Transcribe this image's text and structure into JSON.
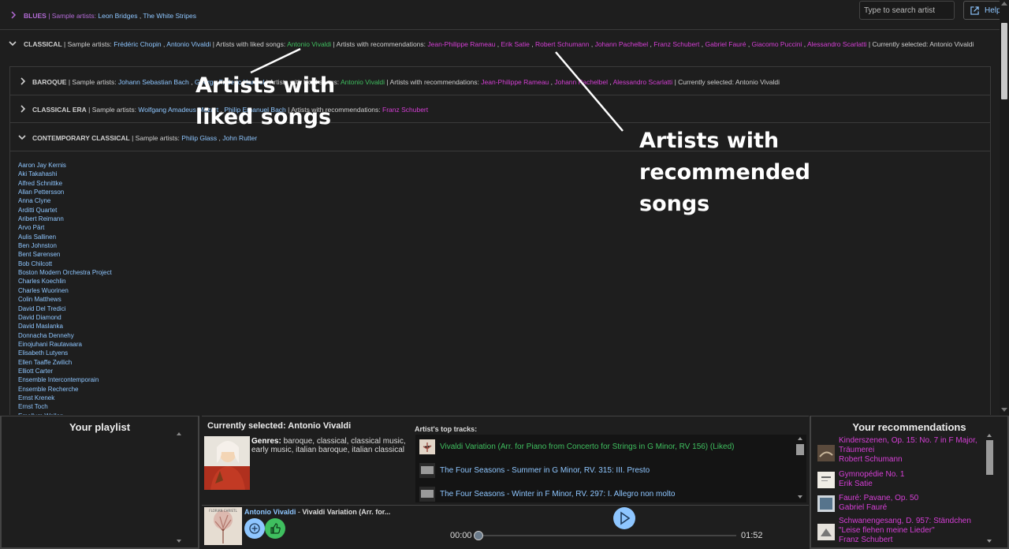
{
  "search": {
    "placeholder": "Type to search artist"
  },
  "help_label": "Help",
  "genres": {
    "blues": {
      "name": "BLUES",
      "sample_label": "| Sample artists:",
      "sample_artists": [
        "Leon Bridges",
        "The White Stripes"
      ]
    },
    "classical": {
      "name": "CLASSICAL",
      "sample_label": "| Sample artists:",
      "sample_artists": [
        "Frédéric Chopin",
        "Antonio Vivaldi"
      ],
      "liked_label": "| Artists with liked songs:",
      "liked_artists": [
        "Antonio Vivaldi"
      ],
      "rec_label": "| Artists with recommendations:",
      "rec_artists": [
        "Jean-Philippe Rameau",
        "Erik Satie",
        "Robert Schumann",
        "Johann Pachelbel",
        "Franz Schubert",
        "Gabriel Fauré",
        "Giacomo Puccini",
        "Alessandro Scarlatti"
      ],
      "selected_text": "| Currently selected: Antonio Vivaldi"
    },
    "baroque": {
      "name": "BAROQUE",
      "sample_label": "| Sample artists:",
      "sample_artists": [
        "Johann Sebastian Bach",
        "George Frideric Handel"
      ],
      "liked_label": "| Artists with liked songs:",
      "liked_artists": [
        "Antonio Vivaldi"
      ],
      "rec_label": "| Artists with recommendations:",
      "rec_artists": [
        "Jean-Philippe Rameau",
        "Johann Pachelbel",
        "Alessandro Scarlatti"
      ],
      "selected_text": "| Currently selected: Antonio Vivaldi"
    },
    "classical_era": {
      "name": "CLASSICAL ERA",
      "sample_label": "| Sample artists:",
      "sample_artists": [
        "Wolfgang Amadeus Mozart",
        "Philip Emanuel Bach"
      ],
      "rec_label": "| Artists with recommendations:",
      "rec_artists": [
        "Franz Schubert"
      ]
    },
    "contemporary": {
      "name": "CONTEMPORARY CLASSICAL",
      "sample_label": "| Sample artists:",
      "sample_artists": [
        "Philip Glass",
        "John Rutter"
      ]
    }
  },
  "artist_list": [
    "Aaron Jay Kernis",
    "Aki Takahashi",
    "Alfred Schnittke",
    "Allan Pettersson",
    "Anna Clyne",
    "Arditti Quartet",
    "Aribert Reimann",
    "Arvo Pärt",
    "Aulis Sallinen",
    "Ben Johnston",
    "Bent Sørensen",
    "Bob Chilcott",
    "Boston Modern Orchestra Project",
    "Charles Koechlin",
    "Charles Wuorinen",
    "Colin Matthews",
    "David Del Tredici",
    "David Diamond",
    "David Maslanka",
    "Donnacha Dennehy",
    "Einojuhani Rautavaara",
    "Elisabeth Lutyens",
    "Ellen Taaffe Zwilich",
    "Elliott Carter",
    "Ensemble Intercontemporain",
    "Ensemble Recherche",
    "Ernst Krenek",
    "Ernst Toch",
    "Emallum Wallen"
  ],
  "annotations": {
    "liked": [
      "Artists with",
      "liked songs"
    ],
    "recommended": [
      "Artists with",
      "recommended",
      "songs"
    ]
  },
  "playlist": {
    "title": "Your playlist"
  },
  "current": {
    "title": "Currently selected: Antonio Vivaldi",
    "genres_label": "Genres:",
    "genres_line1": " baroque, classical, classical music,",
    "genres_line2": "early music, italian baroque, italian classical",
    "top_tracks_label": "Artist's top tracks:",
    "tracks": [
      {
        "title": "Vivaldi Variation (Arr. for Piano from Concerto for Strings in G Minor, RV 156) (Liked)",
        "liked": true
      },
      {
        "title": "The Four Seasons - Summer in G Minor, RV. 315: III. Presto",
        "liked": false
      },
      {
        "title": "The Four Seasons - Winter in F Minor, RV. 297: I. Allegro non molto",
        "liked": false
      }
    ]
  },
  "player": {
    "artist": "Antonio Vivaldi",
    "separator": " - ",
    "track": "Vivaldi Variation (Arr. for...",
    "time_current": "00:00",
    "time_total": "01:52",
    "album_art_text": "FLORIAN CHRISTL"
  },
  "recommendations": {
    "title": "Your recommendations",
    "items": [
      {
        "line1": "Kinderszenen, Op. 15: No. 7 in F Major,",
        "line2": "Träumerei",
        "artist": "Robert Schumann"
      },
      {
        "line1": "Gymnopédie No. 1",
        "line2": "",
        "artist": "Erik Satie"
      },
      {
        "line1": "Fauré: Pavane, Op. 50",
        "line2": "",
        "artist": "Gabriel Fauré"
      },
      {
        "line1": "Schwanengesang, D. 957: Ständchen",
        "line2": "\"Leise flehen meine Lieder\"",
        "artist": "Franz Schubert"
      }
    ]
  },
  "colors": {
    "link": "#8ec6ff",
    "liked": "#3fbf5f",
    "recommended": "#d63fd6",
    "genre": "#b36bd6"
  }
}
